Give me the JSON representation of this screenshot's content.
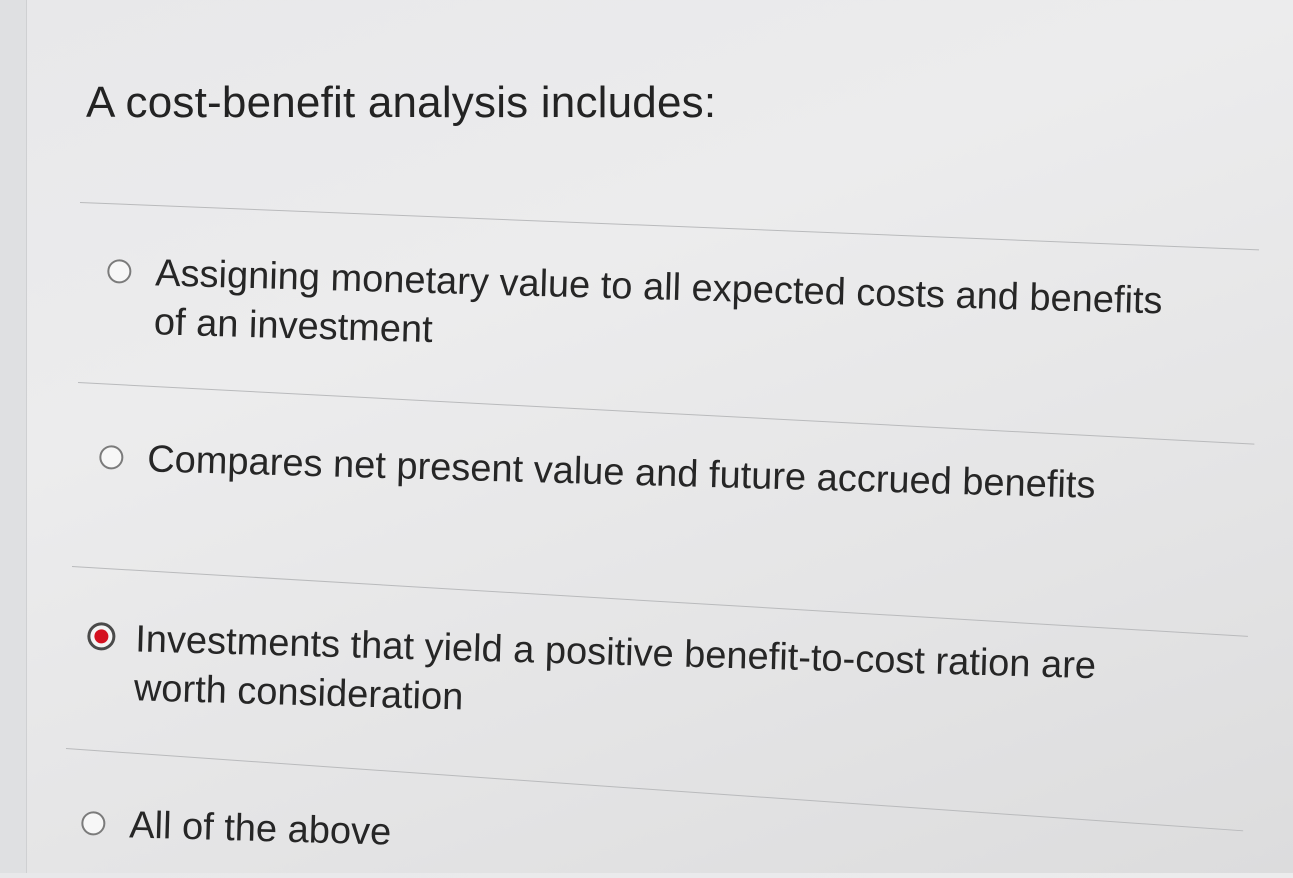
{
  "question": {
    "text": "A cost-benefit analysis includes:"
  },
  "options": [
    {
      "label": "Assigning monetary value to all expected costs and benefits of an investment",
      "selected": false
    },
    {
      "label": "Compares net present value and future accrued benefits",
      "selected": false
    },
    {
      "label": "Investments that yield a positive benefit-to-cost ration are worth consideration",
      "selected": true
    },
    {
      "label": "All of the above",
      "selected": false
    }
  ],
  "colors": {
    "selected_dot": "#d4101f",
    "radio_border": "#7b7b7b",
    "text": "#262626",
    "divider": "#b9babc"
  }
}
